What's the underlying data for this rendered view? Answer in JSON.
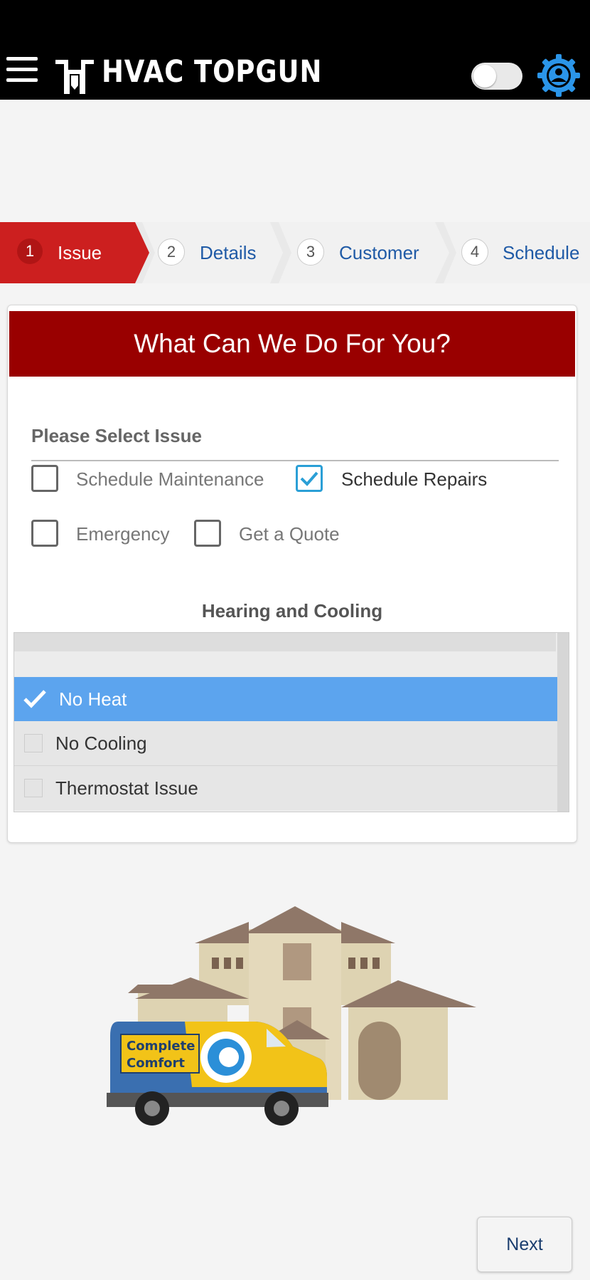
{
  "app": {
    "title": "HVAC TOPGUN"
  },
  "steps": [
    {
      "num": "1",
      "label": "Issue",
      "active": true
    },
    {
      "num": "2",
      "label": "Details",
      "active": false
    },
    {
      "num": "3",
      "label": "Customer",
      "active": false
    },
    {
      "num": "4",
      "label": "Schedule",
      "active": false
    }
  ],
  "card": {
    "title": "What Can We Do For You?",
    "select_label": "Please Select Issue",
    "options": [
      {
        "label": "Schedule Maintenance",
        "checked": false
      },
      {
        "label": "Schedule Repairs",
        "checked": true
      },
      {
        "label": "Emergency",
        "checked": false
      },
      {
        "label": "Get a Quote",
        "checked": false
      }
    ],
    "category_heading": "Hearing and Cooling",
    "list": [
      {
        "label": "No Heat",
        "selected": true
      },
      {
        "label": "No Cooling",
        "selected": false
      },
      {
        "label": "Thermostat Issue",
        "selected": false
      }
    ]
  },
  "illustration": {
    "van_logo_line1": "Complete",
    "van_logo_line2": "Comfort"
  },
  "footer": {
    "next_label": "Next"
  },
  "colors": {
    "accent_red": "#990000",
    "step_red": "#cc1f1f",
    "select_blue": "#5ca4ee",
    "check_blue": "#2a9fd6"
  }
}
